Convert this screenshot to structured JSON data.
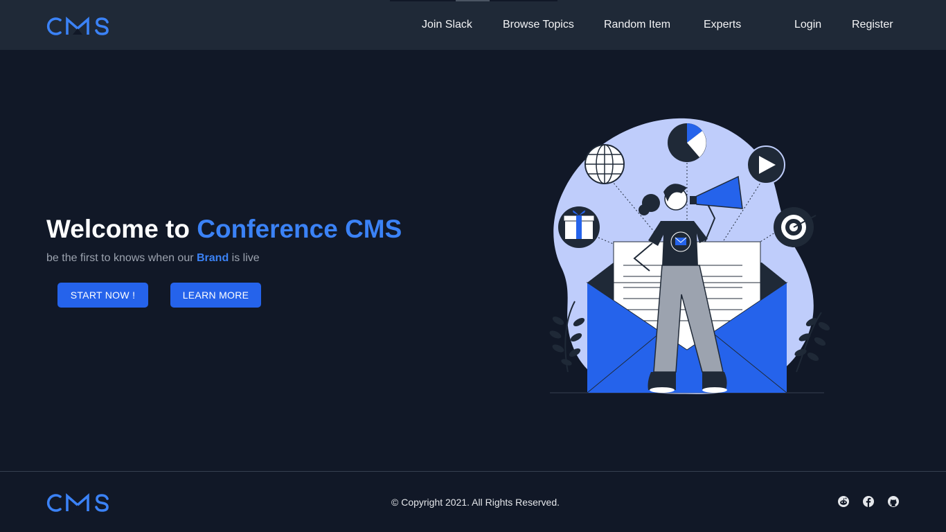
{
  "brand": {
    "logo_text": "CMS",
    "accent_color": "#3b82f6",
    "button_color": "#2563eb",
    "header_bg": "#1f2937",
    "page_bg": "#111827"
  },
  "nav": {
    "links": [
      {
        "label": "Join Slack"
      },
      {
        "label": "Browse Topics"
      },
      {
        "label": "Random Item"
      },
      {
        "label": "Experts"
      }
    ],
    "login": "Login",
    "register": "Register"
  },
  "hero": {
    "title_prefix": "Welcome to ",
    "title_accent": "Conference CMS",
    "subtitle_before": "be the first to knows when our ",
    "subtitle_brand": "Brand",
    "subtitle_after": " is live",
    "primary_button": "START NOW !",
    "secondary_button": "LEARN MORE",
    "illustration_icons": [
      "globe-icon",
      "pie-chart-icon",
      "play-icon",
      "gift-icon",
      "target-icon",
      "megaphone-icon",
      "envelope-icon"
    ]
  },
  "footer": {
    "copyright": "© Copyright 2021. All Rights Reserved.",
    "social_icons": [
      "reddit-icon",
      "facebook-icon",
      "github-icon"
    ]
  }
}
